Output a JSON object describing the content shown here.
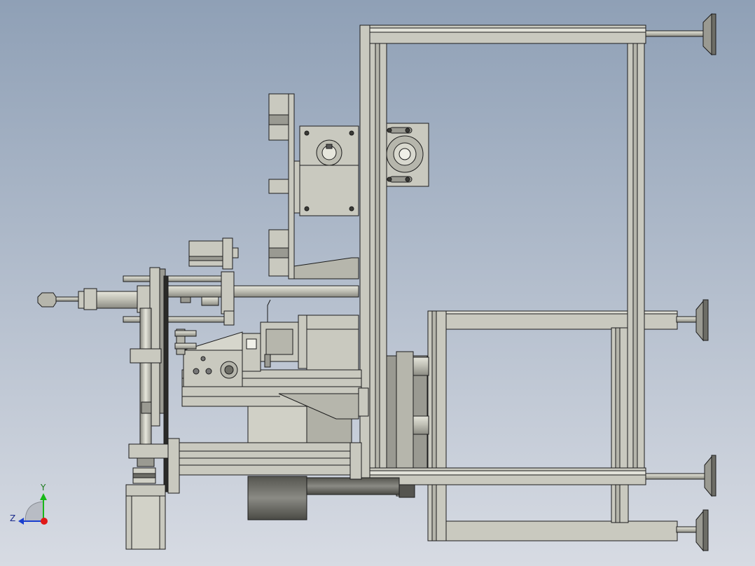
{
  "viewport": {
    "background_top": "#8fa0b6",
    "background_bottom": "#d7dbe3",
    "part_fill": "#c9c9bf",
    "part_dark": "#6d6d66",
    "edge": "#1c1c1c",
    "shadow_fill": "#8c8c86"
  },
  "triad": {
    "y_label": "Y",
    "z_label": "Z",
    "y_color": "#18b818",
    "z_color": "#1a3fcf",
    "x_color": "#e01818",
    "view_icon": "view-orientation-icon"
  }
}
